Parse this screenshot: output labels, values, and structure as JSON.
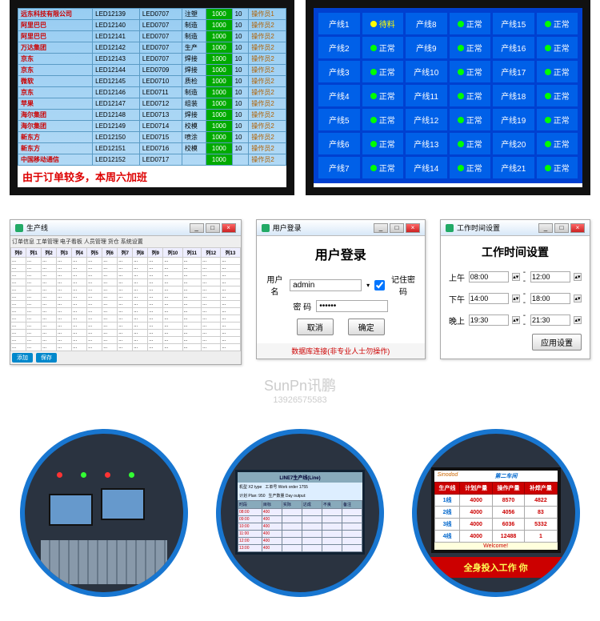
{
  "screen1": {
    "rows": [
      [
        "远东科技有限公司",
        "LED12139",
        "LED0707",
        "注塑",
        "1000",
        "10",
        "操作员1"
      ],
      [
        "阿里巴巴",
        "LED12140",
        "LED0707",
        "制造",
        "1000",
        "10",
        "操作员2"
      ],
      [
        "阿里巴巴",
        "LED12141",
        "LED0707",
        "制造",
        "1000",
        "10",
        "操作员2"
      ],
      [
        "万达集团",
        "LED12142",
        "LED0707",
        "生产",
        "1000",
        "10",
        "操作员2"
      ],
      [
        "京东",
        "LED12143",
        "LED0707",
        "焊接",
        "1000",
        "10",
        "操作员2"
      ],
      [
        "京东",
        "LED12144",
        "LED0709",
        "焊接",
        "1000",
        "10",
        "操作员2"
      ],
      [
        "微软",
        "LED12145",
        "LED0710",
        "质检",
        "1000",
        "10",
        "操作员2"
      ],
      [
        "京东",
        "LED12146",
        "LED0711",
        "制造",
        "1000",
        "10",
        "操作员2"
      ],
      [
        "苹果",
        "LED12147",
        "LED0712",
        "组装",
        "1000",
        "10",
        "操作员2"
      ],
      [
        "海尔集团",
        "LED12148",
        "LED0713",
        "焊接",
        "1000",
        "10",
        "操作员2"
      ],
      [
        "海尔集团",
        "LED12149",
        "LED0714",
        "校模",
        "1000",
        "10",
        "操作员2"
      ],
      [
        "新东方",
        "LED12150",
        "LED0715",
        "喷涂",
        "1000",
        "10",
        "操作员2"
      ],
      [
        "新东方",
        "LED12151",
        "LED0716",
        "校模",
        "1000",
        "10",
        "操作员2"
      ],
      [
        "中国移动通信",
        "LED12152",
        "LED0717",
        "",
        "1000",
        "",
        "操作员2"
      ]
    ],
    "ticker": "由于订单较多，本周六加班"
  },
  "screen2": {
    "cells": [
      [
        "产线1",
        "待料",
        "产线8",
        "正常",
        "产线15",
        "正常"
      ],
      [
        "产线2",
        "正常",
        "产线9",
        "正常",
        "产线16",
        "正常"
      ],
      [
        "产线3",
        "正常",
        "产线10",
        "正常",
        "产线17",
        "正常"
      ],
      [
        "产线4",
        "正常",
        "产线11",
        "正常",
        "产线18",
        "正常"
      ],
      [
        "产线5",
        "正常",
        "产线12",
        "正常",
        "产线19",
        "正常"
      ],
      [
        "产线6",
        "正常",
        "产线13",
        "正常",
        "产线20",
        "正常"
      ],
      [
        "产线7",
        "正常",
        "产线14",
        "正常",
        "产线21",
        "正常"
      ]
    ]
  },
  "login": {
    "winTitle": "用户登录",
    "heading": "用户登录",
    "userLabel": "用户名",
    "userValue": "admin",
    "remember": "记住密码",
    "passLabel": "密 码",
    "cancel": "取消",
    "ok": "确定",
    "warn": "数据库连接(非专业人士勿操作)"
  },
  "worktime": {
    "winTitle": "工作时间设置",
    "heading": "工作时间设置",
    "rows": [
      {
        "label": "上午",
        "from": "08:00",
        "to": "12:00"
      },
      {
        "label": "下午",
        "from": "14:00",
        "to": "18:00"
      },
      {
        "label": "晚上",
        "from": "19:30",
        "to": "21:30"
      }
    ],
    "apply": "应用设置"
  },
  "watermark": {
    "brand": "SunPn讯鹏",
    "phone": "13926575583"
  },
  "spread": {
    "title": "生产线",
    "tabs": "订单信息  工单管理  电子看板  人员管理  货仓  系统设置",
    "btn1": "添加",
    "btn2": "保存"
  },
  "circle2": {
    "title": "LINE7生产线(Line)",
    "info1": "机型 X2 type",
    "info2": "工单号 Work order 1755",
    "info3": "计划 Plan: 950",
    "info4": "生产数量 Day output:",
    "headers": [
      "时段",
      "目标",
      "实际",
      "达成",
      "不良",
      "备注"
    ],
    "rows": [
      [
        "08:00",
        "400",
        "",
        "",
        "",
        ""
      ],
      [
        "09:00",
        "400",
        "",
        "",
        "",
        ""
      ],
      [
        "10:00",
        "400",
        "",
        "",
        "",
        ""
      ],
      [
        "11:00",
        "400",
        "",
        "",
        "",
        ""
      ],
      [
        "12:00",
        "400",
        "",
        "",
        "",
        ""
      ],
      [
        "13:00",
        "400",
        "",
        "",
        "",
        ""
      ]
    ]
  },
  "circle3": {
    "logo": "Sinodod",
    "title": "第二车间",
    "headers": [
      "生产线",
      "计划产量",
      "操作产量",
      "补焊产量"
    ],
    "rows": [
      [
        "1线",
        "4000",
        "8570",
        "4822"
      ],
      [
        "2线",
        "4000",
        "4056",
        "83"
      ],
      [
        "3线",
        "4000",
        "6036",
        "5332"
      ],
      [
        "4线",
        "4000",
        "12488",
        "1"
      ]
    ],
    "welcome": "Welcome!",
    "banner": "全身投入工作  你"
  }
}
